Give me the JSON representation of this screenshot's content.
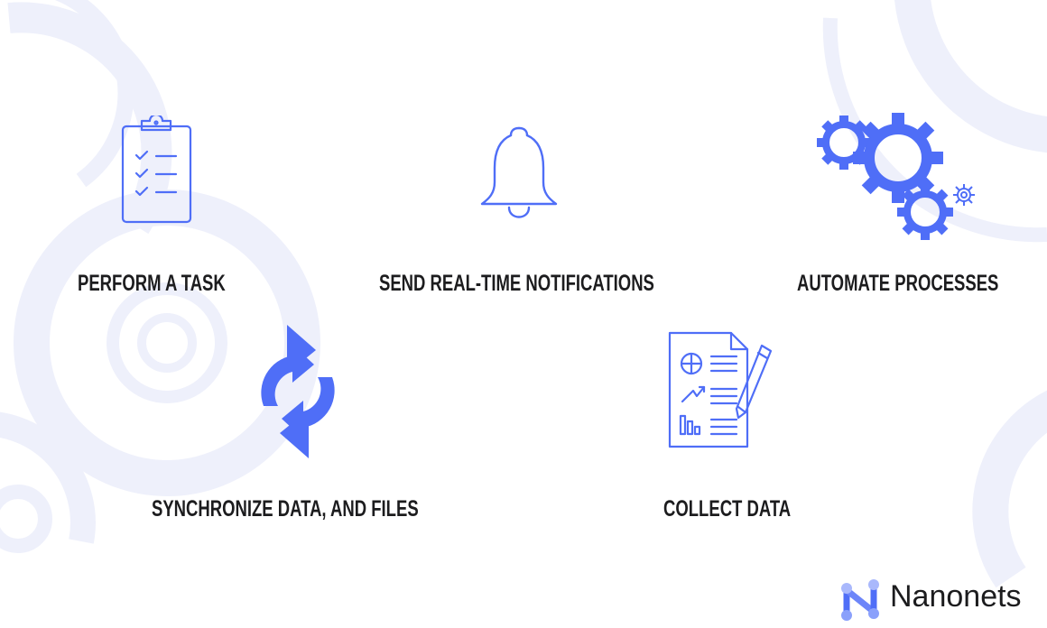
{
  "items": [
    {
      "label": "PERFORM A TASK",
      "icon": "clipboard-checklist-icon"
    },
    {
      "label": "SEND REAL-TIME NOTIFICATIONS",
      "icon": "bell-icon"
    },
    {
      "label": "AUTOMATE PROCESSES",
      "icon": "gears-icon"
    },
    {
      "label": "SYNCHRONIZE DATA, AND FILES",
      "icon": "sync-arrows-icon"
    },
    {
      "label": "COLLECT DATA",
      "icon": "report-document-icon"
    }
  ],
  "brand": {
    "name": "Nanonets",
    "accent_color": "#4f6ef7",
    "background_decor_color": "#eef0fb"
  }
}
